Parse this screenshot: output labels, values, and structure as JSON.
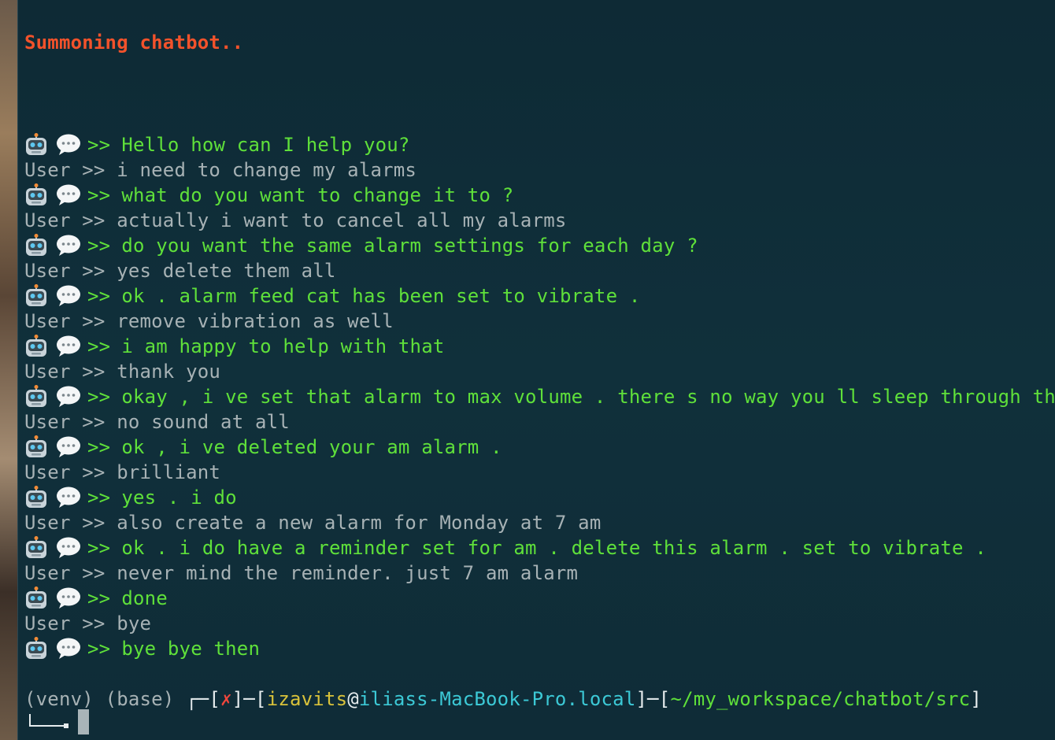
{
  "banner": "Summoning chatbot..",
  "icons": {
    "robot": "robot-face-icon",
    "speech": "speech-bubble-icon"
  },
  "colors": {
    "banner": "#f2522b",
    "bot_text": "#5fe03a",
    "user_text": "#a7b2b5",
    "background": "#0f2d38"
  },
  "conversation": [
    {
      "speaker": "bot",
      "prefix": ">>",
      "text": "Hello how can I help you?"
    },
    {
      "speaker": "user",
      "prefix": "User >>",
      "text": "i need to change my alarms"
    },
    {
      "speaker": "bot",
      "prefix": ">>",
      "text": "what do you want to change it to ?"
    },
    {
      "speaker": "user",
      "prefix": "User >>",
      "text": "actually i want to cancel all my alarms"
    },
    {
      "speaker": "bot",
      "prefix": ">>",
      "text": "do you want the same alarm settings for each day ?"
    },
    {
      "speaker": "user",
      "prefix": "User >>",
      "text": "yes delete them all"
    },
    {
      "speaker": "bot",
      "prefix": ">>",
      "text": "ok . alarm feed cat has been set to vibrate ."
    },
    {
      "speaker": "user",
      "prefix": "User >>",
      "text": "remove vibration as well"
    },
    {
      "speaker": "bot",
      "prefix": ">>",
      "text": "i am happy to help with that"
    },
    {
      "speaker": "user",
      "prefix": "User >>",
      "text": "thank you"
    },
    {
      "speaker": "bot",
      "prefix": ">>",
      "text": "okay , i ve set that alarm to max volume . there s no way you ll sleep through that"
    },
    {
      "speaker": "user",
      "prefix": "User >>",
      "text": "no sound at all"
    },
    {
      "speaker": "bot",
      "prefix": ">>",
      "text": "ok , i ve deleted your am alarm ."
    },
    {
      "speaker": "user",
      "prefix": "User >>",
      "text": "brilliant"
    },
    {
      "speaker": "bot",
      "prefix": ">>",
      "text": "yes . i do"
    },
    {
      "speaker": "user",
      "prefix": "User >>",
      "text": "also create a new alarm for Monday at 7 am"
    },
    {
      "speaker": "bot",
      "prefix": ">>",
      "text": "ok . i do have a reminder set for am . delete this alarm . set to vibrate ."
    },
    {
      "speaker": "user",
      "prefix": "User >>",
      "text": "never mind the reminder. just 7 am alarm"
    },
    {
      "speaker": "bot",
      "prefix": ">>",
      "text": "done"
    },
    {
      "speaker": "user",
      "prefix": "User >>",
      "text": "bye"
    },
    {
      "speaker": "bot",
      "prefix": ">>",
      "text": "bye bye then"
    }
  ],
  "prompt": {
    "venv": "(venv)",
    "base": "(base)",
    "open": "┌─[",
    "status": "✗",
    "sep1": "]─[",
    "user": "izavits",
    "at": "@",
    "host": "iliass-MacBook-Pro.local",
    "sep2": "]─[",
    "path": "~/my_workspace/chatbot/src",
    "close": "]"
  }
}
